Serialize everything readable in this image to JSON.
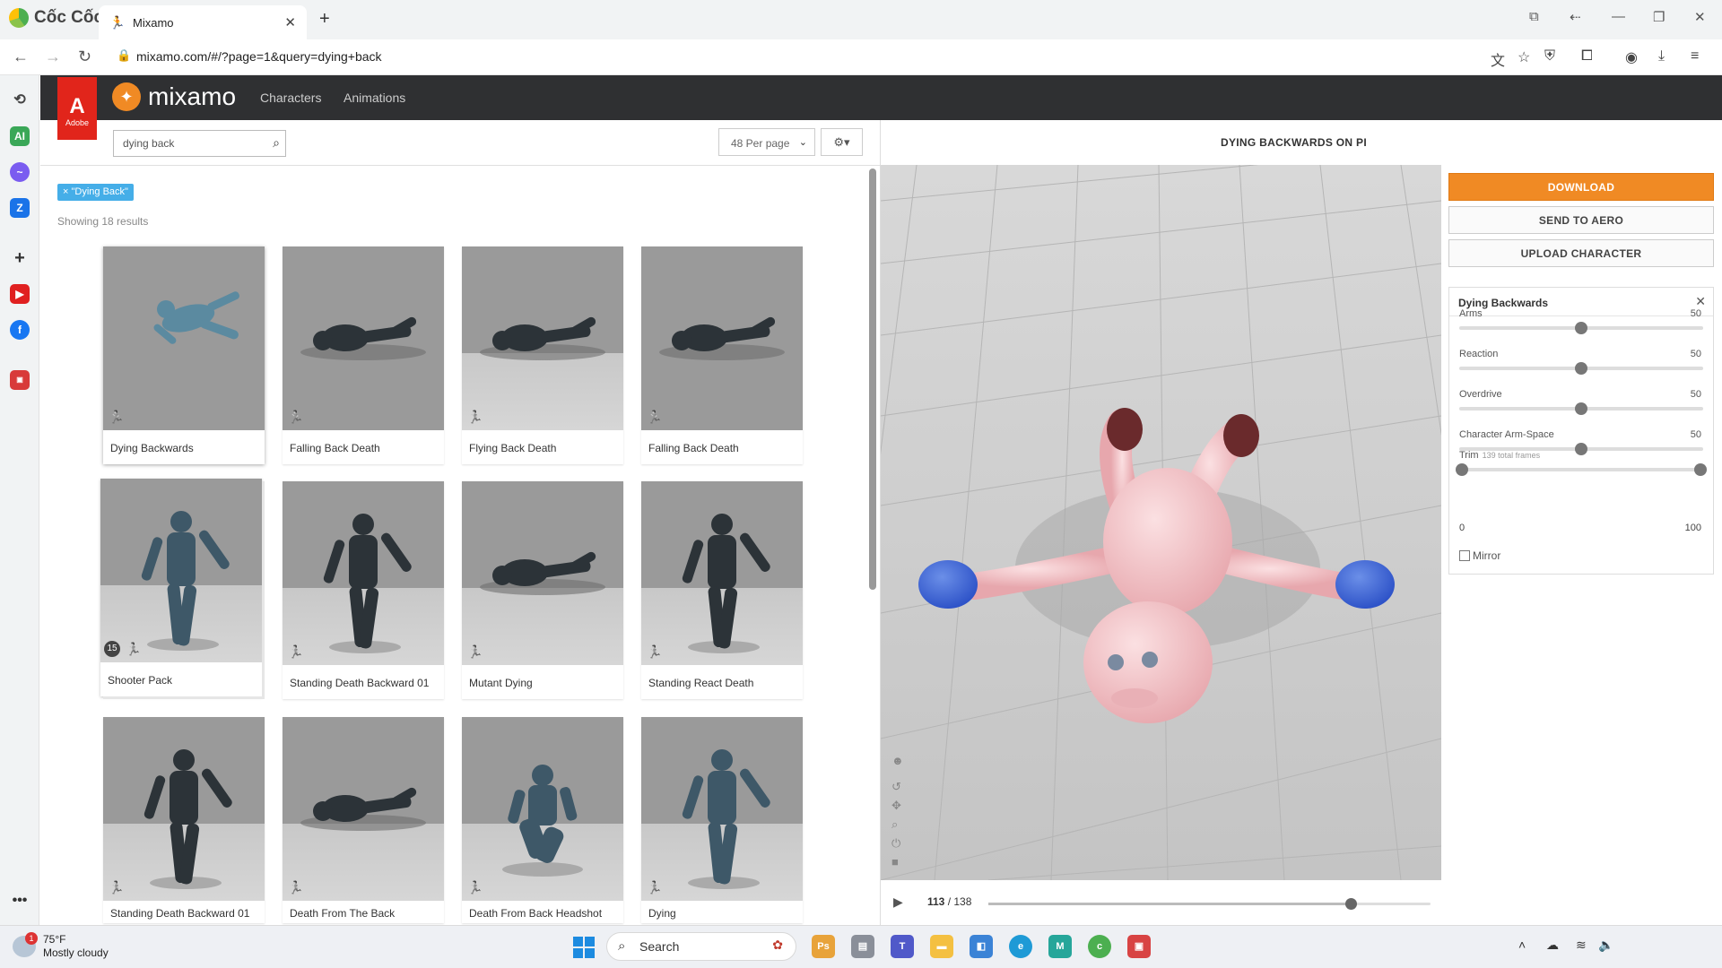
{
  "browser": {
    "brand": "Cốc Cốc",
    "tab_title": "Mixamo",
    "url": "mixamo.com/#/?page=1&query=dying+back"
  },
  "header": {
    "adobe_label": "Adobe",
    "logo_text": "mixamo",
    "nav": [
      "Characters",
      "Animations"
    ]
  },
  "search": {
    "value": "dying back",
    "per_page": "48 Per page"
  },
  "filter_chip": "× \"Dying Back\"",
  "results_text": "Showing 18 results",
  "cards": [
    {
      "label": "Dying Backwards",
      "pose": "fall",
      "floor": false,
      "selected": true
    },
    {
      "label": "Falling Back Death",
      "pose": "lying",
      "floor": false
    },
    {
      "label": "Flying Back Death",
      "pose": "lying",
      "floor": true
    },
    {
      "label": "Falling Back Death",
      "pose": "lying",
      "floor": false
    },
    {
      "label": "Shooter Pack",
      "pose": "stand",
      "floor": true,
      "badge": "15",
      "pack": true
    },
    {
      "label": "Standing Death Backward 01",
      "pose": "stand",
      "floor": true
    },
    {
      "label": "Mutant Dying",
      "pose": "lying",
      "floor": true
    },
    {
      "label": "Standing React Death",
      "pose": "stand",
      "floor": true
    },
    {
      "label": "Standing Death Backward 01",
      "pose": "stand",
      "floor": true
    },
    {
      "label": "Death From The Back",
      "pose": "lying",
      "floor": true
    },
    {
      "label": "Death From Back Headshot",
      "pose": "kneel",
      "floor": true
    },
    {
      "label": "Dying",
      "pose": "stand",
      "floor": true
    }
  ],
  "preview": {
    "title": "DYING BACKWARDS ON PI",
    "frame_current": "113",
    "frame_total": "/ 138",
    "progress": 0.82
  },
  "actions": {
    "download": "DOWNLOAD",
    "send_aero": "SEND TO AERO",
    "upload": "UPLOAD CHARACTER"
  },
  "panel": {
    "title": "Dying Backwards",
    "sliders": [
      {
        "label": "Arms",
        "value": "50",
        "pos": 0.5
      },
      {
        "label": "Reaction",
        "value": "50",
        "pos": 0.5
      },
      {
        "label": "Overdrive",
        "value": "50",
        "pos": 0.5
      },
      {
        "label": "Character Arm-Space",
        "value": "50",
        "pos": 0.5
      }
    ],
    "trim_label": "Trim",
    "trim_sub": "139 total frames",
    "trim_min": "0",
    "trim_max": "100",
    "mirror_label": "Mirror"
  },
  "taskbar": {
    "weather_temp": "75°F",
    "weather_desc": "Mostly cloudy",
    "weather_badge": "1",
    "search_label": "Search"
  },
  "colors": {
    "accent": "#f08a24",
    "chip": "#45aee8",
    "header": "#2f3032"
  }
}
